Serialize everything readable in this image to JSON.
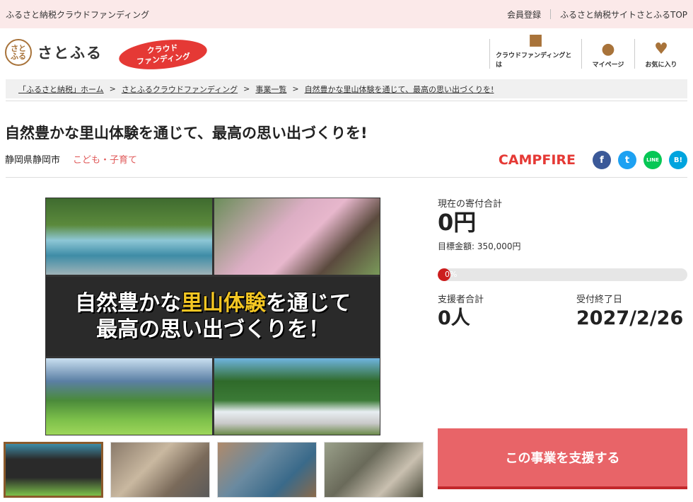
{
  "topbar": {
    "site_label": "ふるさと納税クラウドファンディング",
    "links": [
      "会員登録",
      "ふるさと納税サイトさとふるTOP"
    ]
  },
  "header": {
    "logo_mark": "さと\nふる",
    "logo_text": "さとふる",
    "badge_line1": "クラウド",
    "badge_line2": "ファンディング",
    "nav": [
      {
        "label": "クラウドファンディングとは",
        "icon": "book-icon"
      },
      {
        "label": "マイページ",
        "icon": "user-icon"
      },
      {
        "label": "お気に入り",
        "icon": "heart-icon"
      }
    ]
  },
  "breadcrumb": [
    "「ふるさと納税」ホーム",
    "さとふるクラウドファンディング",
    "事業一覧",
    "自然豊かな里山体験を通じて、最高の思い出づくりを!"
  ],
  "project": {
    "title": "自然豊かな里山体験を通じて、最高の思い出づくりを!",
    "location": "静岡県静岡市",
    "category": "こども・子育て",
    "partner": "CAMPFIRE",
    "share": [
      {
        "label": "f",
        "icon": "facebook-icon"
      },
      {
        "label": "t",
        "icon": "twitter-icon"
      },
      {
        "label": "LINE",
        "icon": "line-icon"
      },
      {
        "label": "B!",
        "icon": "hatena-icon"
      }
    ],
    "banner_line1_a": "自然豊かな",
    "banner_line1_hl": "里山体験",
    "banner_line1_b": "を通じて",
    "banner_line2": "最高の思い出づくりを！"
  },
  "funding": {
    "current_label": "現在の寄付合計",
    "current_value": "0円",
    "goal_text": "目標金額: 350,000円",
    "progress_pct": 0,
    "progress_label": "0%",
    "supporters_label": "支援者合計",
    "supporters_value": "0人",
    "deadline_label": "受付終了日",
    "deadline_value": "2027/2/26",
    "support_button": "この事業を支援する"
  },
  "colors": {
    "accent": "#e86468",
    "brand_brown": "#a8733a",
    "topbar_bg": "#fbe9e9"
  }
}
